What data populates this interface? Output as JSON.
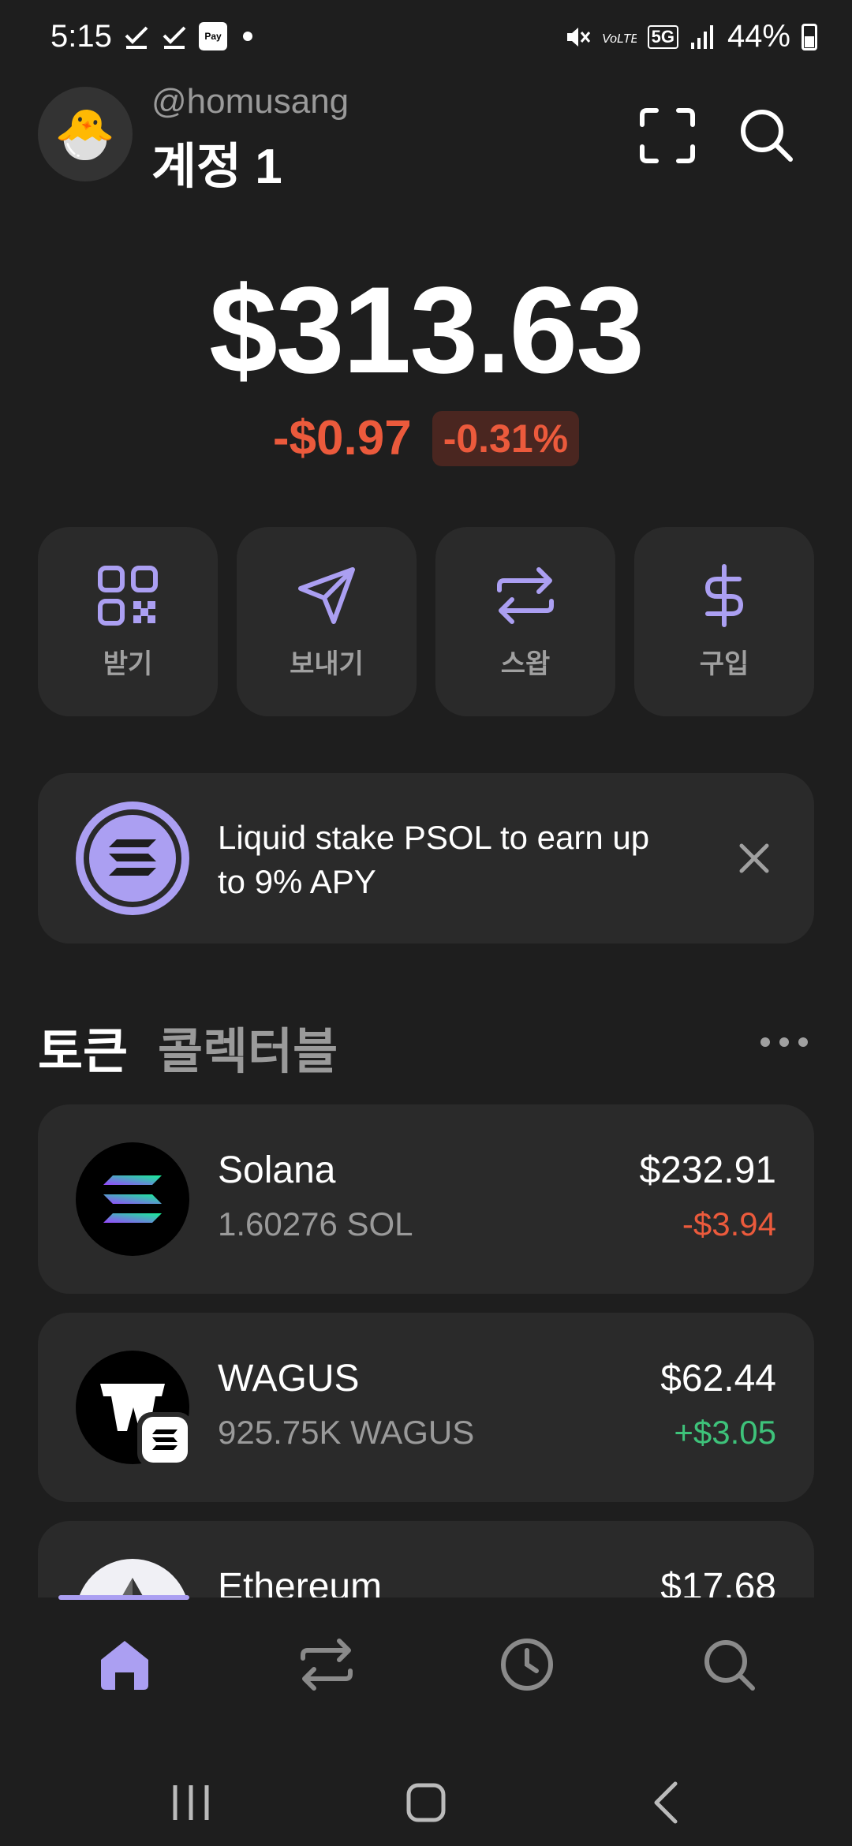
{
  "status_bar": {
    "time": "5:15",
    "network": "5G",
    "battery": "44%",
    "pay_label": "Pay"
  },
  "header": {
    "avatar_emoji": "🐣",
    "handle": "@homusang",
    "account_name": "계정 1",
    "icons": [
      "scan-icon",
      "search-icon"
    ]
  },
  "balance": {
    "total": "$313.63",
    "change_abs": "-$0.97",
    "change_pct": "-0.31%"
  },
  "actions": [
    {
      "label": "받기",
      "icon": "qr-icon"
    },
    {
      "label": "보내기",
      "icon": "send-icon"
    },
    {
      "label": "스왑",
      "icon": "swap-icon"
    },
    {
      "label": "구입",
      "icon": "dollar-icon"
    }
  ],
  "promo": {
    "text": "Liquid stake PSOL to earn up to 9% APY"
  },
  "tabs": {
    "tokens": "토큰",
    "collectibles": "콜렉터블"
  },
  "tokens": [
    {
      "name": "Solana",
      "amount": "1.60276 SOL",
      "value": "$232.91",
      "change": "-$3.94",
      "direction": "negative"
    },
    {
      "name": "WAGUS",
      "amount": "925.75K WAGUS",
      "value": "$62.44",
      "change": "+$3.05",
      "direction": "positive"
    },
    {
      "name": "Ethereum",
      "amount": "",
      "value": "$17.68",
      "change": "",
      "direction": ""
    }
  ],
  "bottom_nav": [
    "home-icon",
    "swap-icon",
    "history-icon",
    "search-icon"
  ],
  "colors": {
    "accent": "#ab9ff2",
    "negative": "#eb5a3c",
    "positive": "#3ec27a",
    "background": "#1e1e1e",
    "card": "#2a2a2a"
  }
}
